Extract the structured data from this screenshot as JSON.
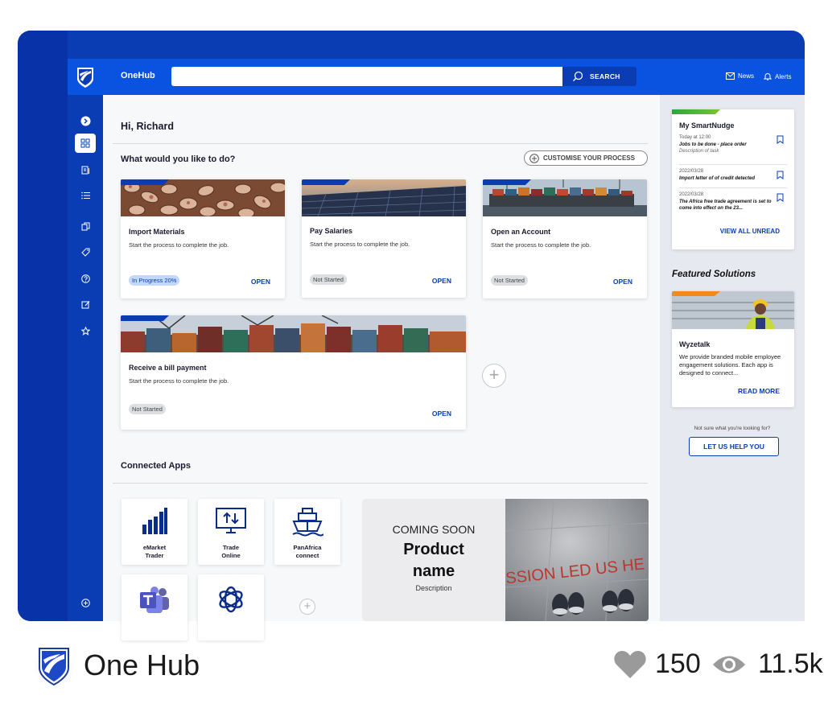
{
  "header": {
    "brand": "OneHub",
    "search_placeholder": "",
    "search_button": "SEARCH",
    "news_label": "News",
    "alerts_label": "Alerts"
  },
  "nav": {
    "items": [
      "chevron-right-icon",
      "dashboard-icon",
      "documents-icon",
      "list-icon",
      "copy-icon",
      "tag-icon",
      "help-icon",
      "edit-icon",
      "star-icon",
      "add-icon"
    ]
  },
  "main": {
    "greeting": "Hi, Richard",
    "section_title": "What would you like to do?",
    "customise_label": "CUSTOMISE YOUR PROCESS",
    "cards": [
      {
        "title": "Import Materials",
        "subtitle": "Start the process to complete the job.",
        "status": "In Progress 20%",
        "action": "OPEN"
      },
      {
        "title": "Pay Salaries",
        "subtitle": "Start the process to complete the job.",
        "status": "Not Started",
        "action": "OPEN"
      },
      {
        "title": "Open an Account",
        "subtitle": "Start the process to complete the job.",
        "status": "Not Started",
        "action": "OPEN"
      },
      {
        "title": "Receive a bill payment",
        "subtitle": "Start the process to complete the job.",
        "status": "Not Started",
        "action": "OPEN"
      }
    ],
    "connected_apps_title": "Connected Apps",
    "apps": [
      {
        "label_line1": "eMarket",
        "label_line2": "Trader",
        "icon": "bar-chart-icon"
      },
      {
        "label_line1": "Trade",
        "label_line2": "Online",
        "icon": "monitor-upload-icon"
      },
      {
        "label_line1": "PanAfrica",
        "label_line2": "connect",
        "icon": "ship-icon"
      },
      {
        "label_line1": "",
        "label_line2": "",
        "icon": "teams-icon"
      },
      {
        "label_line1": "",
        "label_line2": "",
        "icon": "openai-icon"
      }
    ],
    "promo": {
      "coming_soon": "COMING SOON",
      "product_line1": "Product",
      "product_line2": "name",
      "description": "Description",
      "image_text": "SSION LED US HE"
    }
  },
  "right_panel": {
    "nudge": {
      "title": "My SmartNudge",
      "items": [
        {
          "meta": "Today at 12:00",
          "title": "Jobs to be done - place order",
          "desc": "Description of task"
        },
        {
          "meta": "2022/03/28",
          "title": "Import letter of of credit detected",
          "desc": ""
        },
        {
          "meta": "2022/03/28",
          "title": "The Africa free trade agreement is set to come into effect on the 23...",
          "desc": ""
        }
      ],
      "view_all": "VIEW ALL UNREAD"
    },
    "featured_title": "Featured Solutions",
    "featured": {
      "name": "Wyzetalk",
      "description": "We provide branded mobile employee engagement solutions. Each app is designed to connect...",
      "action": "READ MORE"
    },
    "help_note": "Not sure what you're looking for?",
    "help_button": "LET US HELP YOU"
  },
  "footer": {
    "title": "One Hub",
    "likes": "150",
    "views": "11.5k"
  },
  "colors": {
    "brand_blue": "#0a3cb4",
    "topbar_blue": "#0a52e0",
    "progress_badge": "#c3d8ff",
    "nudge_accent": "#27a844",
    "featured_accent": "#f08a1c"
  }
}
